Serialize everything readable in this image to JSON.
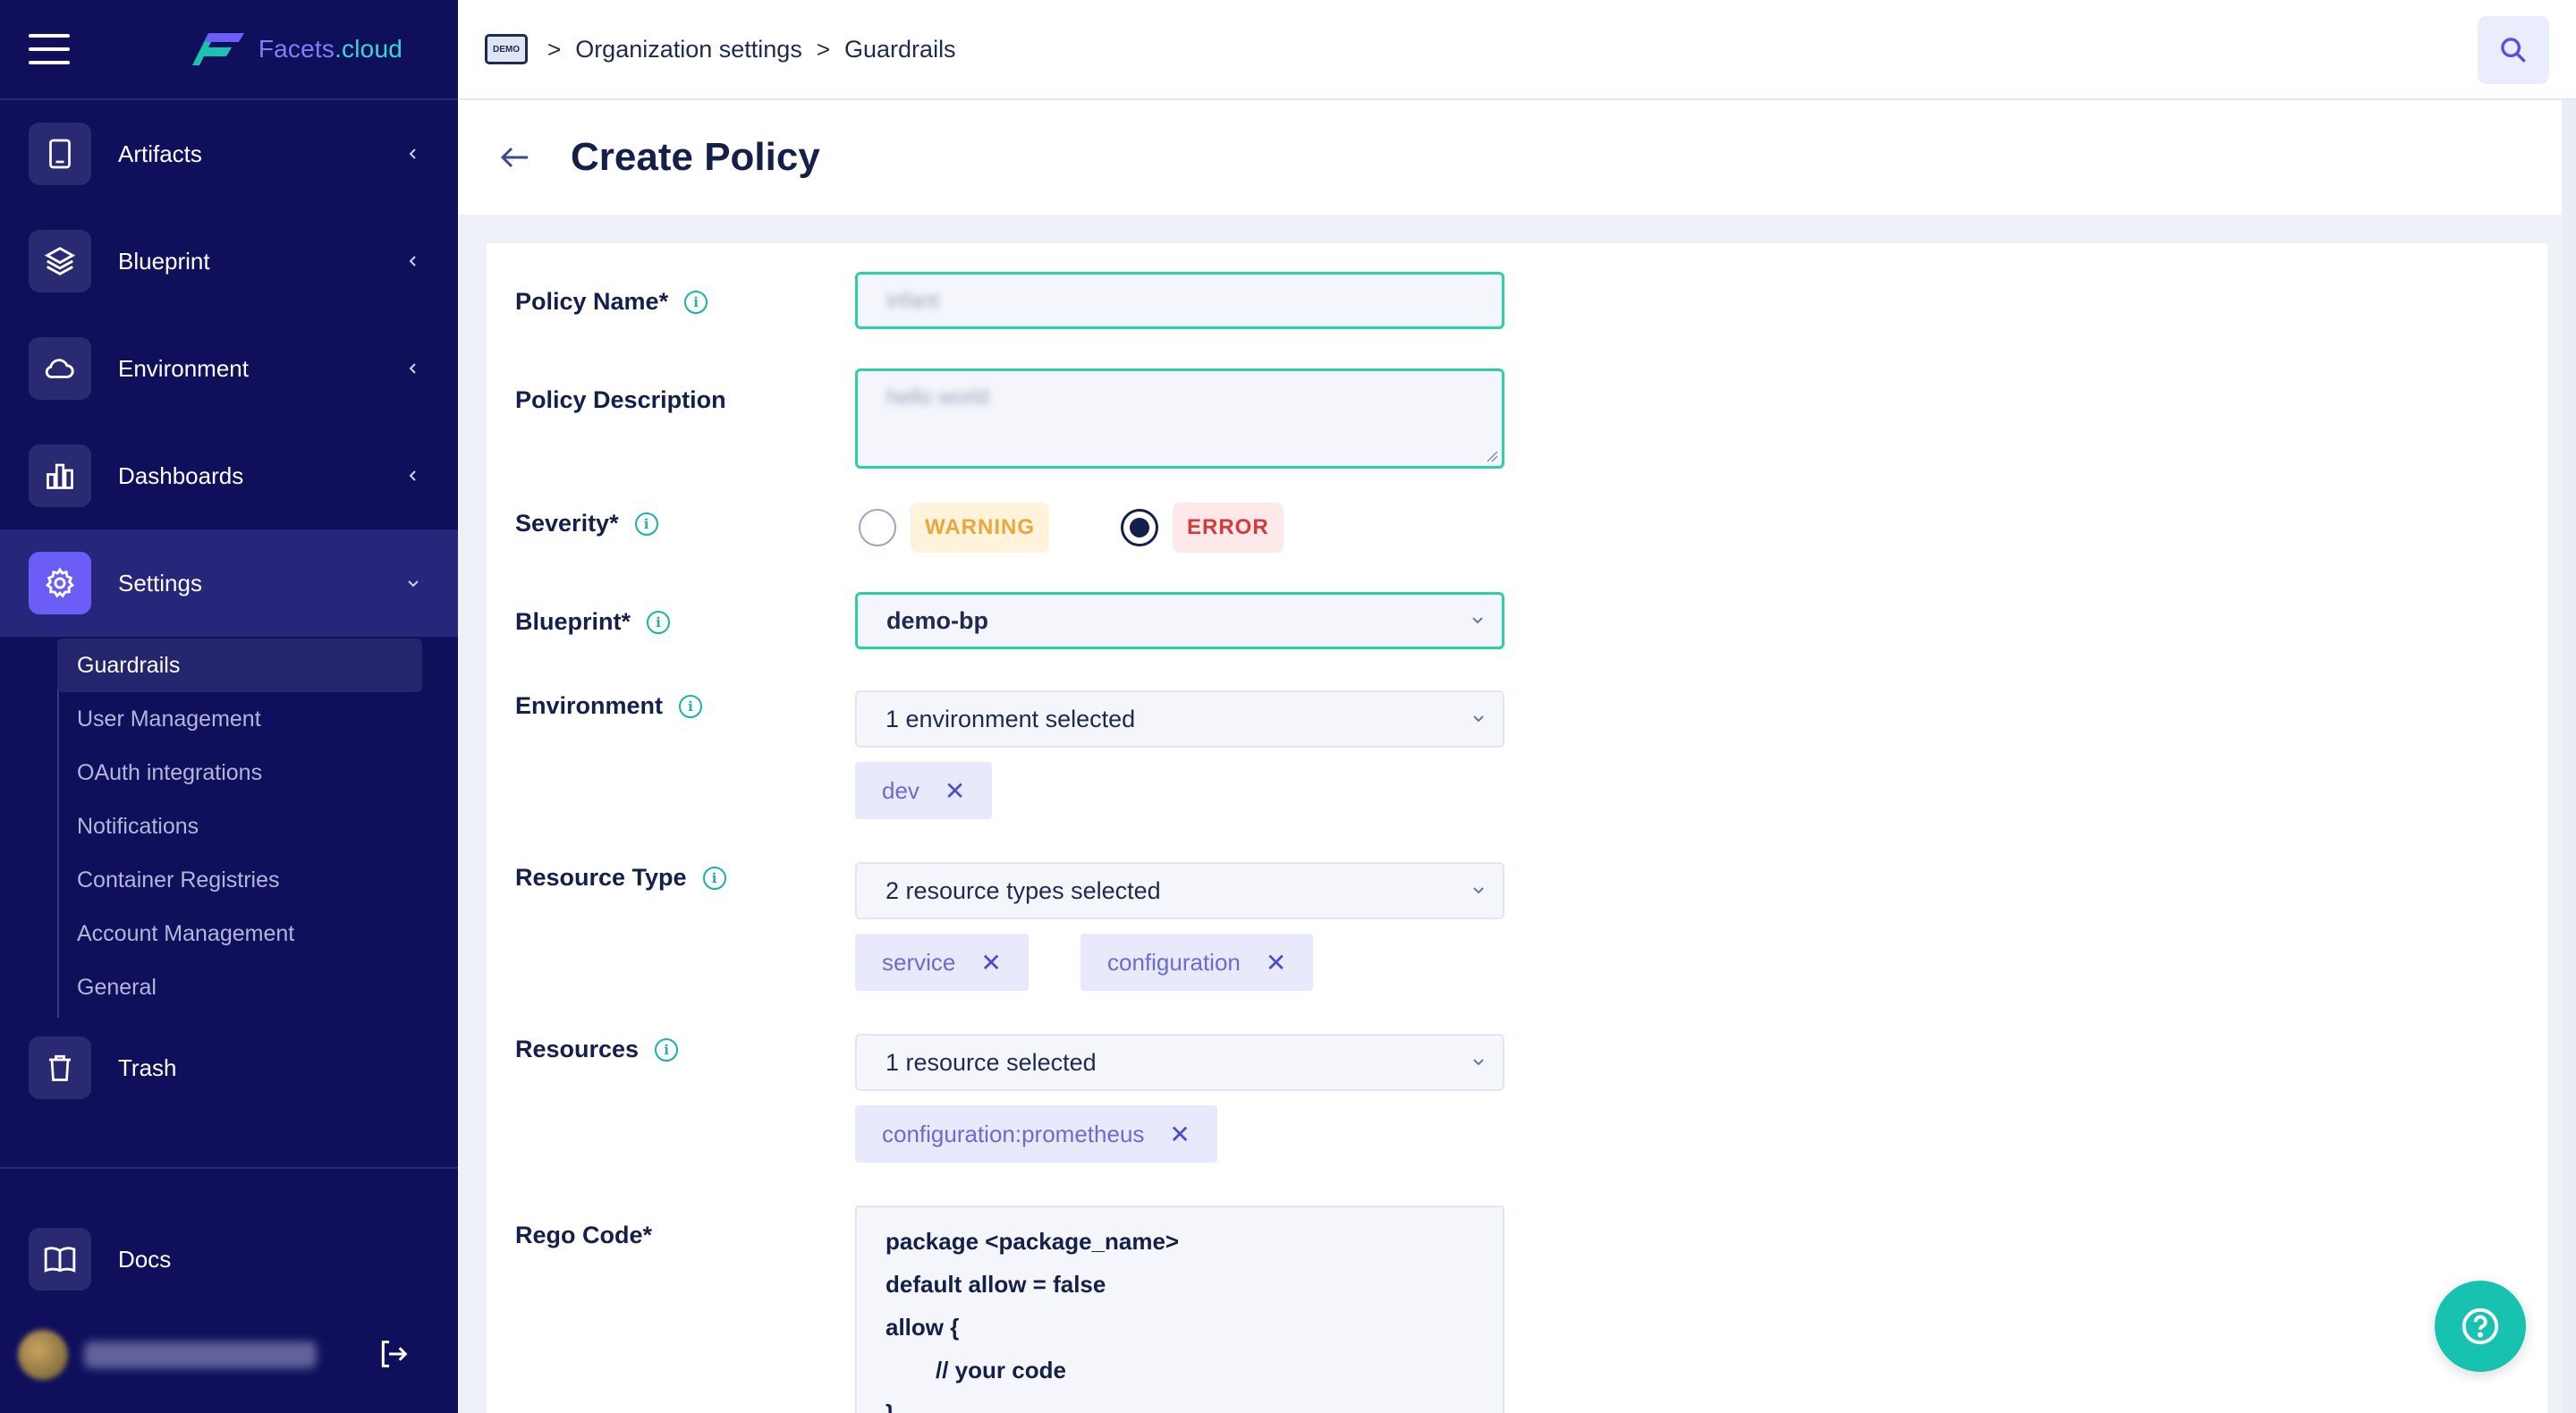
{
  "brand": {
    "name": "Facets",
    "domain": ".cloud"
  },
  "sidebar": {
    "items": [
      {
        "label": "Artifacts",
        "icon": "tablet-icon"
      },
      {
        "label": "Blueprint",
        "icon": "layers-icon"
      },
      {
        "label": "Environment",
        "icon": "cloud-icon"
      },
      {
        "label": "Dashboards",
        "icon": "bar-chart-icon"
      },
      {
        "label": "Settings",
        "icon": "gear-icon"
      }
    ],
    "settings_sub": [
      {
        "label": "Guardrails"
      },
      {
        "label": "User Management"
      },
      {
        "label": "OAuth integrations"
      },
      {
        "label": "Notifications"
      },
      {
        "label": "Container Registries"
      },
      {
        "label": "Account Management"
      },
      {
        "label": "General"
      }
    ],
    "trash": {
      "label": "Trash",
      "icon": "trash-icon"
    },
    "docs": {
      "label": "Docs",
      "icon": "book-icon"
    }
  },
  "header": {
    "demo_badge": "DEMO",
    "breadcrumb": [
      "Organization settings",
      "Guardrails"
    ],
    "sep": ">"
  },
  "page": {
    "title": "Create Policy"
  },
  "form": {
    "policy_name": {
      "label": "Policy Name*",
      "value": "infant"
    },
    "policy_description": {
      "label": "Policy Description",
      "value": "hello world"
    },
    "severity": {
      "label": "Severity*",
      "options": [
        {
          "label": "WARNING",
          "checked": false,
          "color": "#e8a83a",
          "bg": "#fff3dc"
        },
        {
          "label": "ERROR",
          "checked": true,
          "color": "#d63a3a",
          "bg": "#fde9e9"
        }
      ]
    },
    "blueprint": {
      "label": "Blueprint*",
      "value": "demo-bp"
    },
    "environment": {
      "label": "Environment",
      "value": "1 environment selected",
      "chips": [
        "dev"
      ]
    },
    "resource_type": {
      "label": "Resource Type",
      "value": "2 resource types selected",
      "chips": [
        "service",
        "configuration"
      ]
    },
    "resources": {
      "label": "Resources",
      "value": "1 resource selected",
      "chips": [
        "configuration:prometheus"
      ]
    },
    "rego_code": {
      "label": "Rego Code*",
      "lines": [
        "package <package_name>",
        "default allow = false",
        "allow {",
        "// your code",
        "}"
      ]
    }
  },
  "chip_remove": "✕",
  "colors": {
    "accent": "#2dcfa5",
    "sidebar_bg": "#0f0f5c",
    "primary": "#6b5df6",
    "help": "#17c2b0"
  }
}
